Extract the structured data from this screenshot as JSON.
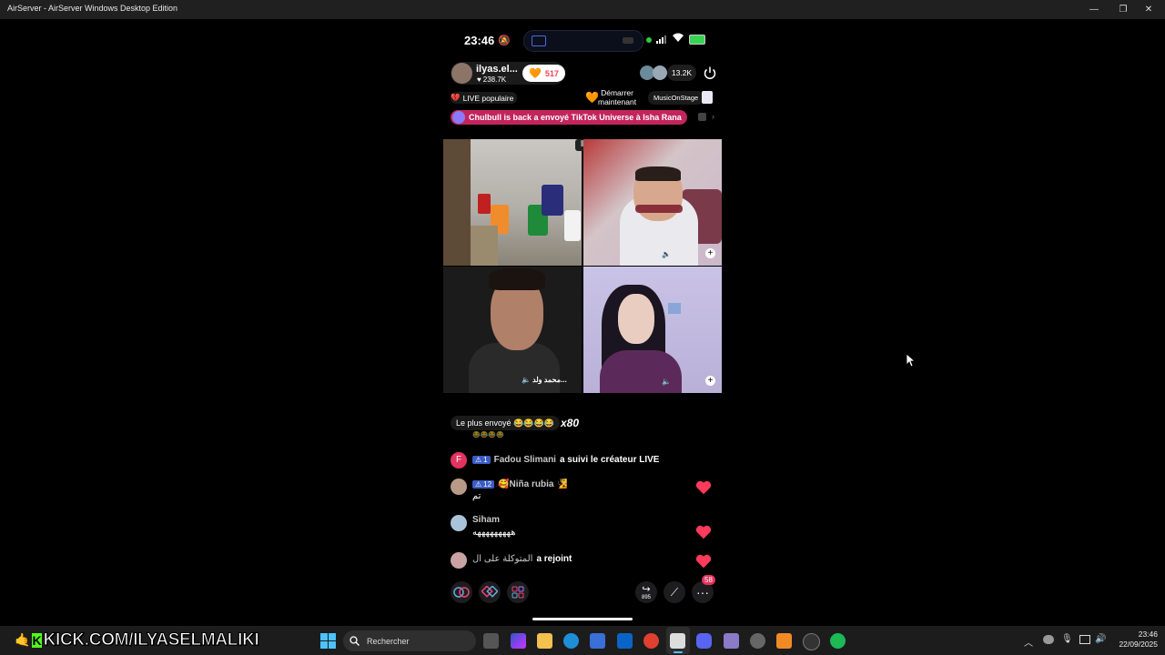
{
  "window": {
    "title": "AirServer - AirServer Windows Desktop Edition",
    "controls": [
      "minimize",
      "maximize",
      "close"
    ]
  },
  "phone": {
    "status": {
      "time": "23:46"
    },
    "host": {
      "name": "ilyas.el...",
      "likes": "238.7K",
      "gift_count": "517",
      "viewers": "13.2K"
    },
    "tags": {
      "popular": "LIVE populaire",
      "start_line1": "Démarrer",
      "start_line2": "maintenant",
      "music": "MusicOnStage"
    },
    "banner": "Chulbull is back a envoyé TikTok Universe à Isha Rana",
    "guests": {
      "bottom_left_name": "محمد ولد..."
    },
    "most_sent": {
      "label": "Le plus envoyé 😂😂😂😂",
      "count": "x80"
    },
    "chat": [
      {
        "initial": "F",
        "badge": "1",
        "user": "Fadou Slimani",
        "text": "a suivi le créateur LIVE"
      },
      {
        "badge": "12",
        "user": "🥰Niña rubia 🧏",
        "text": "تم"
      },
      {
        "user": "Siham",
        "text": "هههههههههه"
      },
      {
        "user": "المتوكلة على ال",
        "text": "a rejoint"
      }
    ],
    "bottom_bar": {
      "share_count": "895",
      "notif_badge": "58"
    }
  },
  "overlay": {
    "text": "KICK.COM/ILYASELMALIKI"
  },
  "taskbar": {
    "search_placeholder": "Rechercher",
    "clock_time": "23:46",
    "clock_date": "22/09/2025"
  },
  "colors": {
    "accent_pink": "#e2335f",
    "heart_red": "#ff3b5c",
    "kick_green": "#53fc18",
    "titlebar": "#202020",
    "taskbar": "#1c1c1c"
  }
}
